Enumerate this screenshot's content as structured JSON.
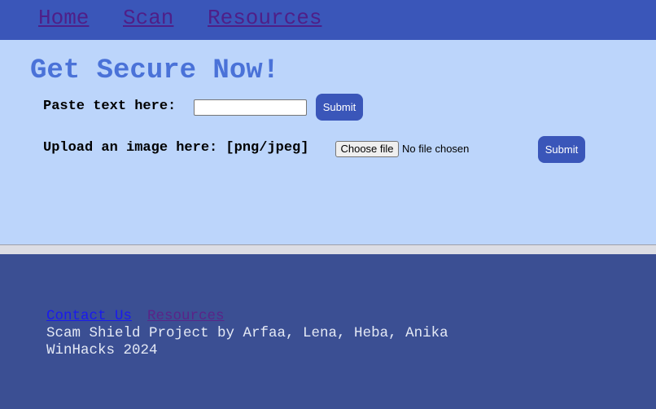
{
  "nav": {
    "items": [
      {
        "label": "Home"
      },
      {
        "label": "Scan"
      },
      {
        "label": "Resources"
      }
    ]
  },
  "main": {
    "title": "Get Secure Now!",
    "text_form": {
      "label": "Paste text here:",
      "value": "",
      "submit_label": "Submit"
    },
    "image_form": {
      "label": "Upload an image here: [png/jpeg]",
      "choose_file_label": "Choose file",
      "file_status": "No file chosen",
      "submit_label": "Submit"
    }
  },
  "footer": {
    "links": [
      {
        "label": "Contact Us"
      },
      {
        "label": "Resources"
      }
    ],
    "credit": "Scam Shield Project by Arfaa, Lena, Heba, Anika",
    "event": "WinHacks 2024"
  },
  "colors": {
    "nav_bg": "#3a56b9",
    "main_bg": "#bcd5fb",
    "title": "#4a72d8",
    "footer_bg": "#3b4f93",
    "link_unvisited": "#1a1aee",
    "link_visited": "#5a2488"
  }
}
